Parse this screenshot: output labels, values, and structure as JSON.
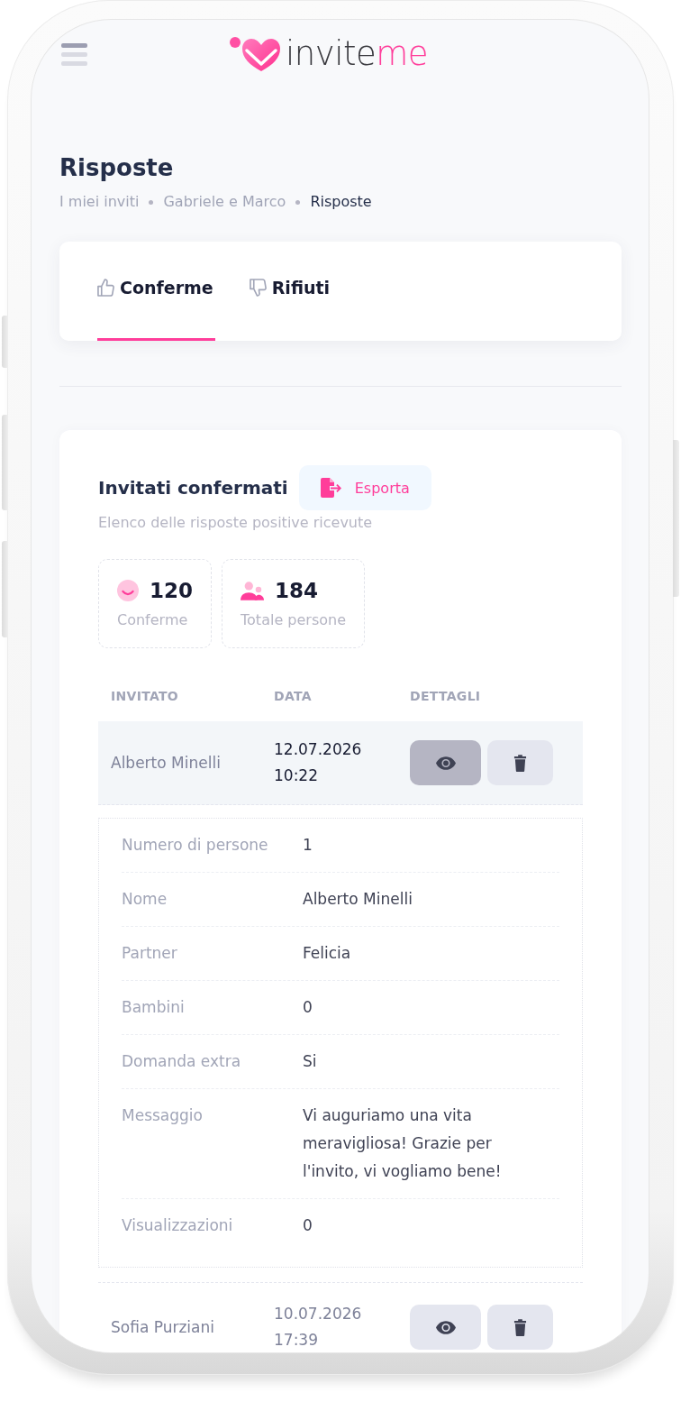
{
  "header": {
    "logo": {
      "text": "invite",
      "accent": "me"
    }
  },
  "page": {
    "title": "Risposte",
    "breadcrumb": [
      {
        "label": "I miei inviti",
        "current": false
      },
      {
        "label": "Gabriele e Marco",
        "current": false
      },
      {
        "label": "Risposte",
        "current": true
      }
    ]
  },
  "tabs": [
    {
      "label": "Conferme",
      "kind": "thumbs_up",
      "selected": true
    },
    {
      "label": "Rifiuti",
      "kind": "thumbs_down",
      "selected": false
    }
  ],
  "card": {
    "title": "Invitati confermati",
    "export_button": {
      "label": "Esporta"
    },
    "subtitle": "Elenco delle risposte positive ricevute",
    "stats": [
      {
        "kind": "smile",
        "value": "120",
        "label": "Conferme"
      },
      {
        "kind": "people",
        "value": "184",
        "label": "Totale persone"
      }
    ],
    "table": {
      "columns": [
        "INVITATO",
        "DATA",
        "DETTAGLI"
      ],
      "rows": [
        {
          "name": "Alberto Minelli",
          "date": "12.07.2026",
          "time": "10:22",
          "expanded": true,
          "details": [
            {
              "label": "Numero di persone",
              "value": "1"
            },
            {
              "label": "Nome",
              "value": "Alberto Minelli"
            },
            {
              "label": "Partner",
              "value": "Felicia"
            },
            {
              "label": "Bambini",
              "value": "0"
            },
            {
              "label": "Domanda extra",
              "value": "Si"
            },
            {
              "label": "Messaggio",
              "value": "Vi auguriamo una vita meravigliosa! Grazie per l'invito, vi vogliamo bene!"
            },
            {
              "label": "Visualizzazioni",
              "value": "0"
            }
          ]
        },
        {
          "name": "Sofia Purziani",
          "date": "10.07.2026",
          "time": "17:39",
          "expanded": false
        }
      ]
    }
  }
}
